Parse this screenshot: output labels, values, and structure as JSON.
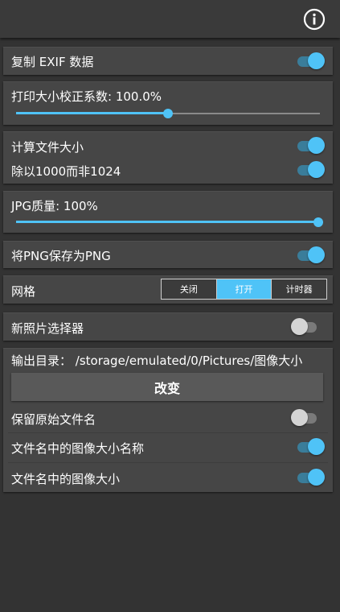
{
  "header": {
    "info_icon": "info-icon"
  },
  "copy_exif": {
    "label": "复制 EXIF 数据",
    "enabled": true
  },
  "print_size": {
    "label": "打印大小校正系数: 100.0%",
    "fraction": 0.5
  },
  "file_size": {
    "calc_label": "计算文件大小",
    "calc_enabled": true,
    "divide_label": "除以1000而非1024",
    "divide_enabled": true
  },
  "jpg_quality": {
    "label": "JPG质量: 100%",
    "fraction": 1.0
  },
  "png": {
    "label": "将PNG保存为PNG",
    "enabled": true
  },
  "grid": {
    "label": "网格",
    "options": [
      "关闭",
      "打开",
      "计时器"
    ],
    "selected": 1
  },
  "new_picker": {
    "label": "新照片选择器",
    "enabled": false
  },
  "output": {
    "dir_label": "输出目录：  /storage/emulated/0/Pictures/图像大小",
    "change_label": "改变",
    "keep_name_label": "保留原始文件名",
    "keep_name_enabled": false,
    "size_name_label": "文件名中的图像大小名称",
    "size_name_enabled": true,
    "size_label": "文件名中的图像大小",
    "size_enabled": true
  },
  "colors": {
    "accent": "#4fc3f7",
    "background": "#333333",
    "card": "#464646"
  }
}
